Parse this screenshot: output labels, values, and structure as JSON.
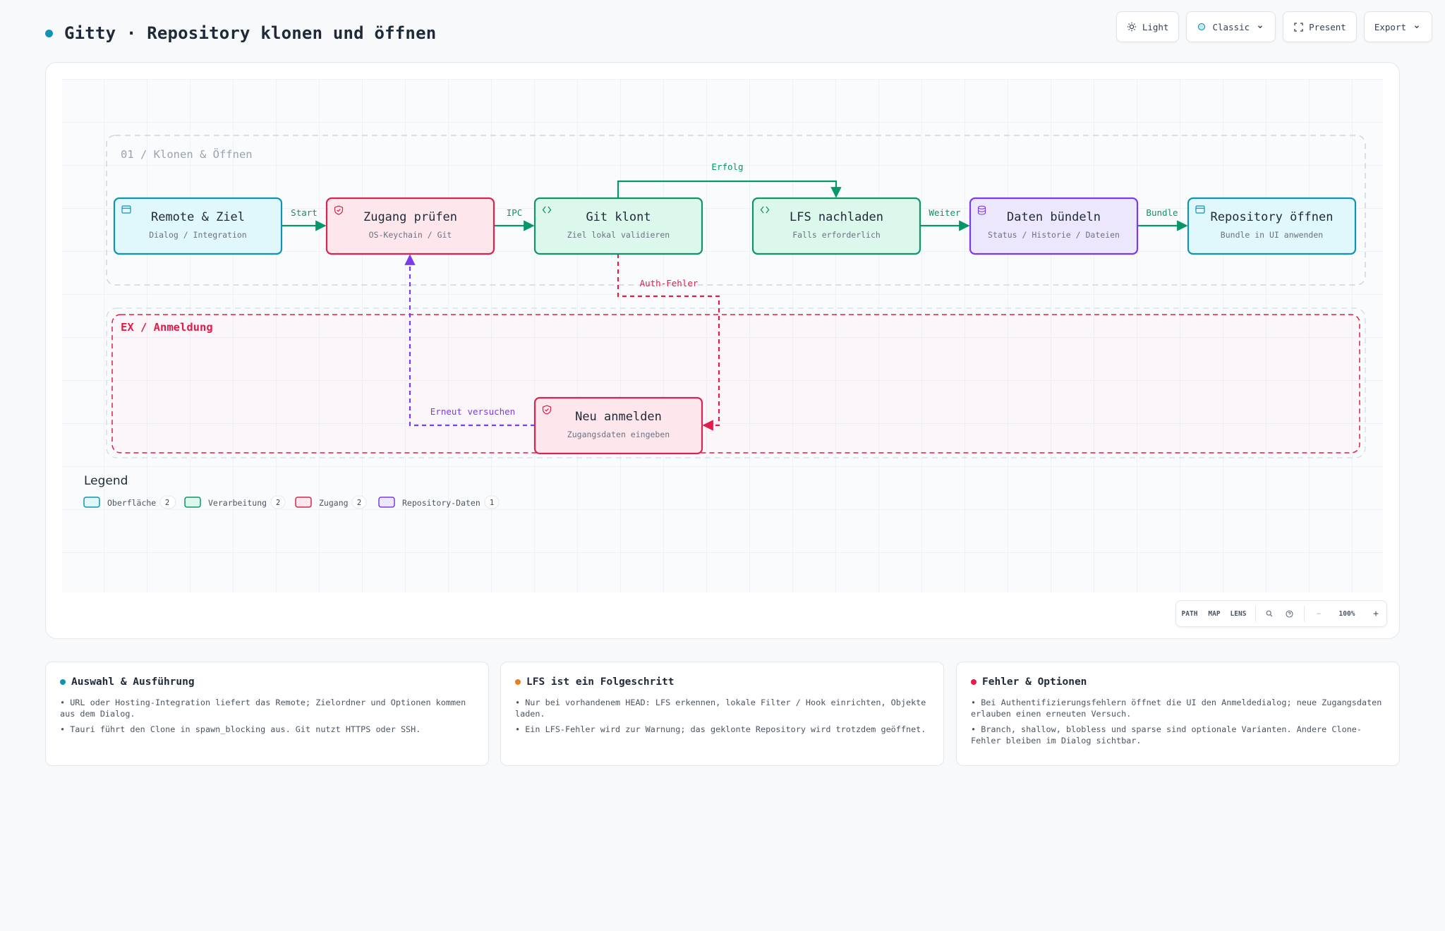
{
  "header": {
    "title": "Gitty · Repository klonen und öffnen",
    "accent": "#0e94b4"
  },
  "toolbar": {
    "theme_label": "Light",
    "style_label": "Classic",
    "present_label": "Present",
    "export_label": "Export"
  },
  "groups": [
    {
      "id": "g1",
      "label": "01 / Klonen & Öffnen",
      "color": "#9aa3b2"
    },
    {
      "id": "g2",
      "label": "EX / Anmeldung",
      "color": "#e11d48"
    }
  ],
  "nodes": [
    {
      "id": "remote",
      "title": "Remote & Ziel",
      "subtitle": "Dialog / Integration",
      "category": "surface",
      "icon": "window-icon"
    },
    {
      "id": "zugang",
      "title": "Zugang prüfen",
      "subtitle": "OS-Keychain / Git",
      "category": "access",
      "icon": "shield-icon"
    },
    {
      "id": "clone",
      "title": "Git klont",
      "subtitle": "Ziel lokal validieren",
      "category": "processing",
      "icon": "code-icon"
    },
    {
      "id": "lfs",
      "title": "LFS nachladen",
      "subtitle": "Falls erforderlich",
      "category": "processing",
      "icon": "code-icon"
    },
    {
      "id": "bundle",
      "title": "Daten bündeln",
      "subtitle": "Status / Historie / Dateien",
      "category": "data",
      "icon": "database-icon"
    },
    {
      "id": "open",
      "title": "Repository öffnen",
      "subtitle": "Bundle in UI anwenden",
      "category": "surface",
      "icon": "window-icon"
    },
    {
      "id": "relogin",
      "title": "Neu anmelden",
      "subtitle": "Zugangsdaten eingeben",
      "category": "access",
      "icon": "shield-icon"
    }
  ],
  "edges": [
    {
      "from": "remote",
      "to": "zugang",
      "label": "Start",
      "style": "solid",
      "color": "#059669"
    },
    {
      "from": "zugang",
      "to": "clone",
      "label": "IPC",
      "style": "solid",
      "color": "#059669"
    },
    {
      "from": "clone",
      "to": "lfs",
      "label": "Erfolg",
      "style": "solid",
      "color": "#059669"
    },
    {
      "from": "lfs",
      "to": "bundle",
      "label": "Weiter",
      "style": "solid",
      "color": "#059669"
    },
    {
      "from": "bundle",
      "to": "open",
      "label": "Bundle",
      "style": "solid",
      "color": "#059669"
    },
    {
      "from": "clone",
      "to": "relogin",
      "label": "Auth-Fehler",
      "style": "dashed",
      "color": "#e11d48"
    },
    {
      "from": "relogin",
      "to": "zugang",
      "label": "Erneut versuchen",
      "style": "dashed",
      "color": "#7c3aed"
    }
  ],
  "categories": {
    "surface": {
      "fill": "#e0f7fb",
      "stroke": "#0e94b4",
      "icon_color": "#0e94b4"
    },
    "access": {
      "fill": "#fde7ec",
      "stroke": "#d6264f",
      "icon_color": "#d6264f"
    },
    "processing": {
      "fill": "#dcf7ec",
      "stroke": "#10946a",
      "icon_color": "#10946a"
    },
    "data": {
      "fill": "#ede7fd",
      "stroke": "#7c3aed",
      "icon_color": "#7c3aed"
    }
  },
  "legend": {
    "title": "Legend",
    "items": [
      {
        "category": "surface",
        "label": "Oberfläche",
        "count": "2"
      },
      {
        "category": "processing",
        "label": "Verarbeitung",
        "count": "2"
      },
      {
        "category": "access",
        "label": "Zugang",
        "count": "2"
      },
      {
        "category": "data",
        "label": "Repository-Daten",
        "count": "1"
      }
    ]
  },
  "zoombar": {
    "path": "PATH",
    "map": "MAP",
    "lens": "LENS",
    "zoom": "100%",
    "minus": "−",
    "plus": "+"
  },
  "notes": [
    {
      "title": "Auswahl & Ausführung",
      "dot_color": "#0e94b4",
      "items": [
        "• URL oder Hosting-Integration liefert das Remote; Zielordner und Optionen kommen aus dem Dialog.",
        "• Tauri führt den Clone in spawn_blocking aus. Git nutzt HTTPS oder SSH."
      ]
    },
    {
      "title": "LFS ist ein Folgeschritt",
      "dot_color": "#e67e22",
      "items": [
        "• Nur bei vorhandenem HEAD: LFS erkennen, lokale Filter / Hook einrichten, Objekte laden.",
        "• Ein LFS-Fehler wird zur Warnung; das geklonte Repository wird trotzdem geöffnet."
      ]
    },
    {
      "title": "Fehler & Optionen",
      "dot_color": "#e11d48",
      "items": [
        "• Bei Authentifizierungsfehlern öffnet die UI den Anmeldedialog; neue Zugangsdaten erlauben einen erneuten Versuch.",
        "• Branch, shallow, blobless und sparse sind optionale Varianten. Andere Clone-Fehler bleiben im Dialog sichtbar."
      ]
    }
  ]
}
